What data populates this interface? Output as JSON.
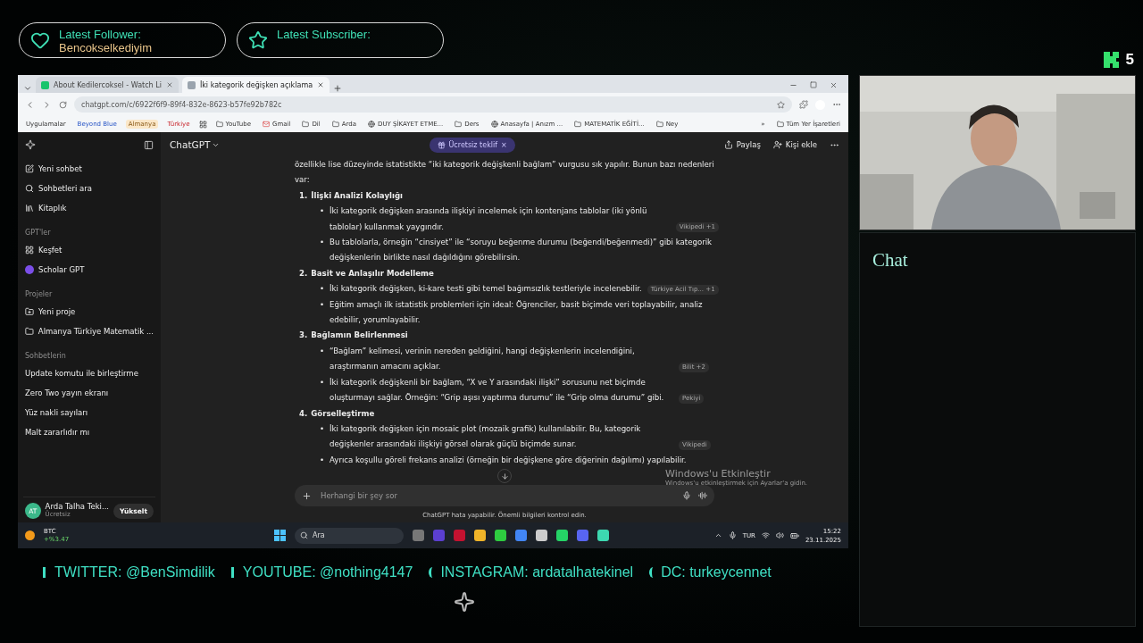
{
  "overlay": {
    "follower": {
      "label": "Latest Follower:",
      "value": "Bencokselkediyim"
    },
    "subscriber": {
      "label": "Latest Subscriber:"
    },
    "viewer_count": "5"
  },
  "browser": {
    "tabs": [
      {
        "title": "About Kedilercoksel - Watch Li",
        "selected": false
      },
      {
        "title": "İki kategorik değişken açıklama",
        "selected": true
      }
    ],
    "url": "chatgpt.com/c/6922f6f9-89f4-832e-8623-b57fe92b782c",
    "bookmarks": [
      "Uygulamalar",
      "Beyond Blue",
      "Almanya",
      "Türkiye",
      "YouTube",
      "Gmail",
      "Dil",
      "Arda",
      "DUY ŞİKAYET ETME...",
      "Ders",
      "Anasayfa | Anızm ...",
      "MATEMATİK EĞİTİ...",
      "Ney"
    ],
    "overflow": "»",
    "all_bookmarks": "Tüm Yer İşaretleri"
  },
  "chatgpt": {
    "sidebar": {
      "nav": [
        "Yeni sohbet",
        "Sohbetleri ara",
        "Kitaplık"
      ],
      "gpts_heading": "GPT'ler",
      "gpts": [
        "Keşfet",
        "Scholar GPT"
      ],
      "projects_heading": "Projeler",
      "projects": [
        "Yeni proje",
        "Almanya Türkiye Matematik ..."
      ],
      "chats_heading": "Sohbetlerin",
      "chats": [
        "Update komutu ile birleştirme",
        "Zero Two yayın ekranı",
        "Yüz nakli sayıları",
        "Malt zararlıdır mı"
      ],
      "user": {
        "initials": "AT",
        "name": "Arda Talha Teki...",
        "plan": "Ücretsiz",
        "upgrade": "Yükselt"
      }
    },
    "header": {
      "model": "ChatGPT",
      "offer": "Ücretsiz teklif",
      "offer_close": "×",
      "share": "Paylaş",
      "add_person": "Kişi ekle"
    },
    "bullet": "•",
    "intro": "özellikle lise düzeyinde istatistikte “iki kategorik değişkenli bağlam” vurgusu sık yapılır. Bunun bazı nedenleri var:",
    "sections": [
      {
        "number": "1.",
        "title": "İlişki Analizi Kolaylığı",
        "bullets": [
          {
            "text": "İki kategorik değişken arasında ilişkiyi incelemek için kontenjans tablolar (iki yönlü tablolar) kullanmak yaygındır.",
            "source": "Vikipedi +1"
          },
          {
            "text": "Bu tablolarla, örneğin “cinsiyet” ile “soruyu beğenme durumu (beğendi/beğenmedi)” gibi kategorik değişkenlerin birlikte nasıl dağıldığını görebilirsin."
          }
        ]
      },
      {
        "number": "2.",
        "title": "Basit ve Anlaşılır Modelleme",
        "bullets": [
          {
            "text": "İki kategorik değişken, ki-kare testi gibi temel bağımsızlık testleriyle incelenebilir.",
            "source": "Türkiye Acil Tıp... +1"
          },
          {
            "text": "Eğitim amaçlı ilk istatistik problemleri için ideal: Öğrenciler, basit biçimde veri toplayabilir, analiz edebilir, yorumlayabilir."
          }
        ]
      },
      {
        "number": "3.",
        "title": "Bağlamın Belirlenmesi",
        "bullets": [
          {
            "text": "“Bağlam” kelimesi, verinin nereden geldiğini, hangi değişkenlerin incelendiğini, araştırmanın amacını açıklar.",
            "source": "Bilit +2"
          },
          {
            "text": "İki kategorik değişkenli bir bağlam, “X ve Y arasındaki ilişki” sorusunu net biçimde oluşturmayı sağlar. Örneğin: “Grip aşısı yaptırma durumu” ile “Grip olma durumu” gibi.",
            "source": "Pekiyi"
          }
        ]
      },
      {
        "number": "4.",
        "title": "Görselleştirme",
        "bullets": [
          {
            "text": "İki kategorik değişken için mosaic plot (mozaik grafik) kullanılabilir. Bu, kategorik değişkenler arasındaki ilişkiyi görsel olarak güçlü biçimde sunar.",
            "source": "Vikipedi"
          },
          {
            "text": "Ayrıca koşullu göreli frekans analizi (örneğin bir değişkene göre diğerinin dağılımı) yapılabilir."
          }
        ]
      }
    ],
    "composer": {
      "placeholder": "Herhangi bir şey sor"
    },
    "disclaimer": "ChatGPT hata yapabilir. Önemli bilgileri kontrol edin.",
    "activation": {
      "title": "Windows'u Etkinleştir",
      "hint": "Windows'u etkinleştirmek için Ayarlar'a gidin."
    }
  },
  "taskbar": {
    "ticker": "BTC",
    "change": "+%3.47",
    "search": "Ara",
    "language": "TUR",
    "time": "15:22",
    "date": "23.11.2025"
  },
  "socials": [
    "TWITTER: @BenSimdilik",
    "YOUTUBE: @nothing4147",
    "INSTAGRAM: ardatalhatekinel",
    "DC: turkeycennet"
  ],
  "chat_panel": {
    "title": "Chat"
  }
}
